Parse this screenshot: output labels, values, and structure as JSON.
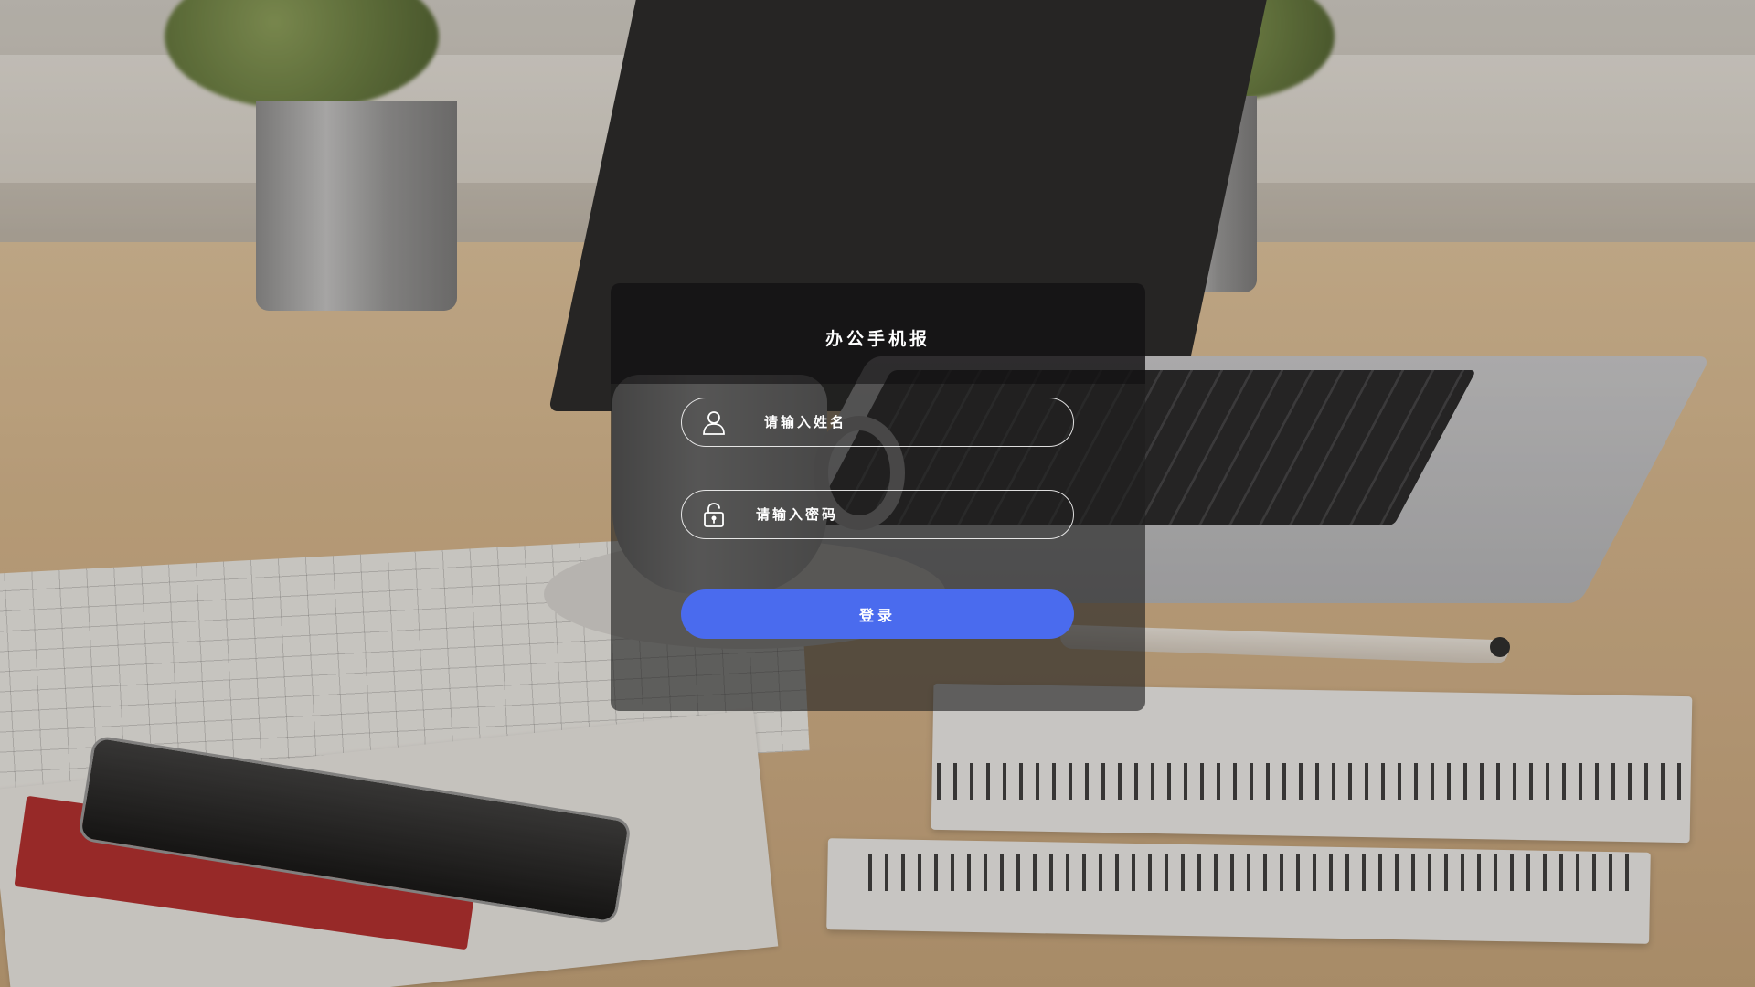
{
  "app": {
    "title": "办公手机报"
  },
  "login_form": {
    "username": {
      "placeholder": "请输入姓名",
      "value": "",
      "icon": "user-icon"
    },
    "password": {
      "placeholder": "请输入密码",
      "value": "",
      "icon": "lock-icon"
    },
    "submit_label": "登录"
  },
  "colors": {
    "accent": "#4a6bee",
    "panel_background": "rgba(30,30,30,0.62)",
    "text": "#ffffff"
  }
}
